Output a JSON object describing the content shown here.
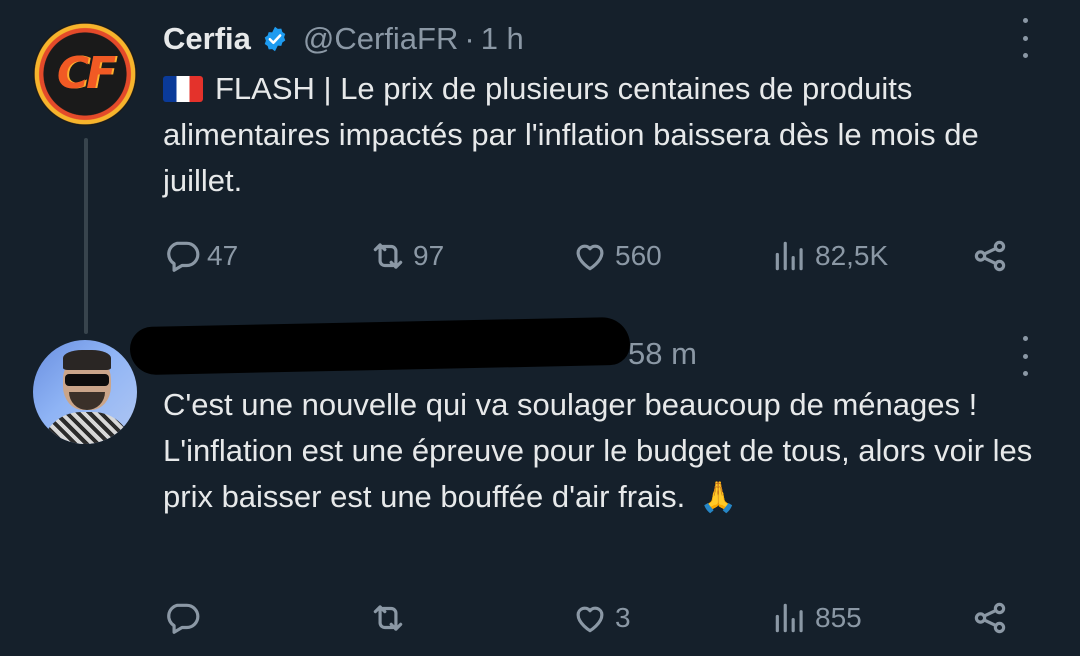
{
  "tweet": {
    "display_name": "Cerfia",
    "handle": "@CerfiaFR",
    "separator": "·",
    "time": "1 h",
    "avatar_logo": "CF",
    "text": "FLASH | Le prix de plusieurs centaines de produits alimentaires impactés par l'inflation baissera dès le mois de juillet.",
    "flag_icon": "france-flag-icon",
    "stats": {
      "replies": "47",
      "retweets": "97",
      "likes": "560",
      "views": "82,5K"
    }
  },
  "reply": {
    "display_name_redacted": true,
    "time": "58 m",
    "text": "C'est une nouvelle qui va soulager beaucoup de ménages ! L'inflation est une épreuve pour le budget de tous, alors voir les prix baisser est une bouffée d'air frais.",
    "emoji": "🙏",
    "stats": {
      "replies": "",
      "retweets": "",
      "likes": "3",
      "views": "855"
    }
  },
  "icons": [
    "verified-badge-icon",
    "more-icon",
    "reply-icon",
    "retweet-icon",
    "like-icon",
    "views-icon",
    "share-icon"
  ],
  "colors": {
    "background": "#15202b",
    "text": "#e7e9ea",
    "secondary": "#8b98a5",
    "verified": "#1d9bf0"
  }
}
